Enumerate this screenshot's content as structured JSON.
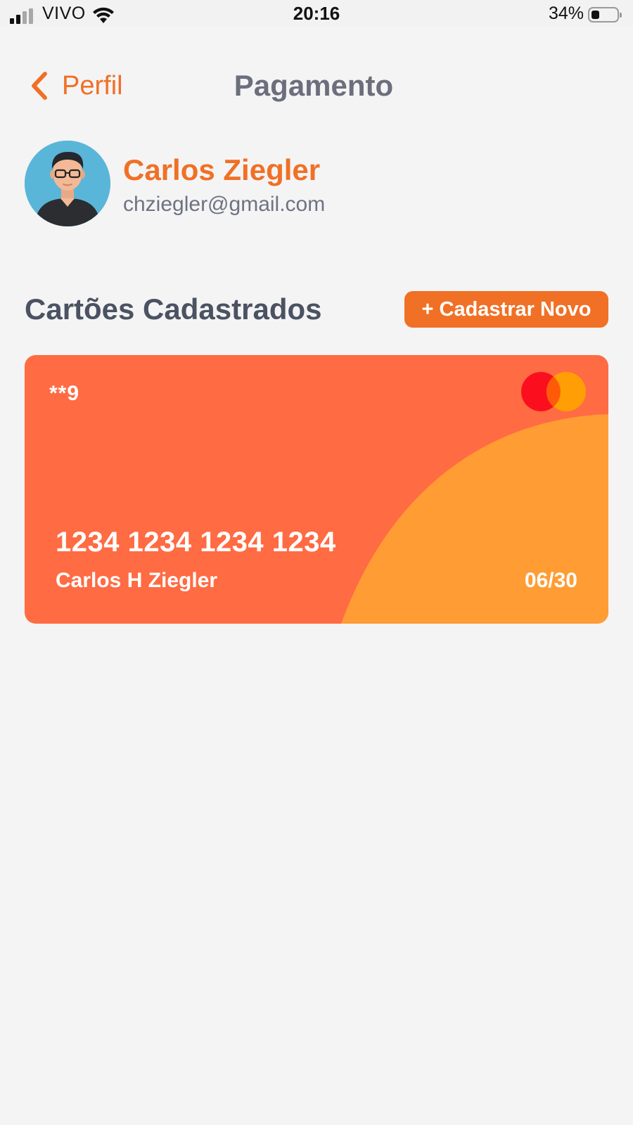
{
  "status_bar": {
    "carrier": "VIVO",
    "time": "20:16",
    "battery_percent": "34%"
  },
  "nav": {
    "back_label": "Perfil",
    "title": "Pagamento"
  },
  "profile": {
    "name": "Carlos Ziegler",
    "email": "chziegler@gmail.com"
  },
  "cards_section": {
    "title": "Cartões Cadastrados",
    "add_button": "+ Cadastrar Novo"
  },
  "cards": [
    {
      "masked": "**9",
      "number": "1234 1234 1234 1234",
      "holder": "Carlos H Ziegler",
      "expiry": "06/30",
      "brand_icon": "mastercard-icon"
    }
  ],
  "colors": {
    "accent": "#f07025",
    "card_base": "#ff6b43",
    "card_wave": "#ff9c34",
    "background": "#f4f4f5"
  }
}
